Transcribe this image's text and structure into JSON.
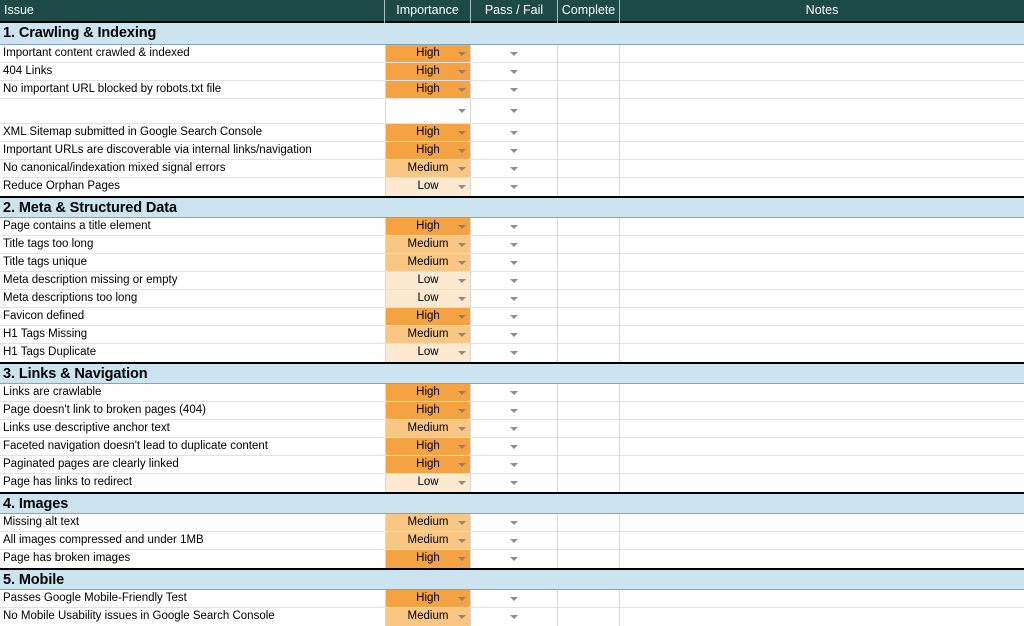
{
  "header": {
    "columns": [
      {
        "label": "Issue",
        "align": "left"
      },
      {
        "label": "Importance",
        "align": "center"
      },
      {
        "label": "Pass / Fail",
        "align": "center"
      },
      {
        "label": "Complete",
        "align": "center"
      },
      {
        "label": "Notes",
        "align": "center"
      }
    ]
  },
  "colors": {
    "header_background": "#1d4a47",
    "header_text": "#ffffff",
    "section_background": "#cce4ef",
    "importance_high": "#f5a342",
    "importance_medium": "#fac684",
    "importance_low": "#fde8d0",
    "grid_line": "#e2e2e2",
    "section_border": "#000000"
  },
  "icons": {
    "dropdown": "chevron-down-icon"
  },
  "sections": [
    {
      "title": "1. Crawling & Indexing",
      "rows": [
        {
          "issue": "Important content crawled & indexed",
          "importance": "High",
          "pass_fail": "",
          "complete": "",
          "notes": ""
        },
        {
          "issue": "404 Links",
          "importance": "High",
          "pass_fail": "",
          "complete": "",
          "notes": ""
        },
        {
          "issue": "No important URL blocked by robots.txt file",
          "importance": "High",
          "pass_fail": "",
          "complete": "",
          "notes": ""
        },
        {
          "issue": "",
          "importance": "",
          "pass_fail": "",
          "complete": "",
          "notes": ""
        },
        {
          "issue": "XML Sitemap submitted in Google Search Console",
          "importance": "High",
          "pass_fail": "",
          "complete": "",
          "notes": ""
        },
        {
          "issue": "Important URLs are discoverable via internal links/navigation",
          "importance": "High",
          "pass_fail": "",
          "complete": "",
          "notes": ""
        },
        {
          "issue": "No canonical/indexation mixed signal errors",
          "importance": "Medium",
          "pass_fail": "",
          "complete": "",
          "notes": ""
        },
        {
          "issue": "Reduce Orphan Pages",
          "importance": "Low",
          "pass_fail": "",
          "complete": "",
          "notes": ""
        }
      ]
    },
    {
      "title": "2. Meta & Structured Data",
      "rows": [
        {
          "issue": "Page contains a title element",
          "importance": "High",
          "pass_fail": "",
          "complete": "",
          "notes": ""
        },
        {
          "issue": "Title tags too long",
          "importance": "Medium",
          "pass_fail": "",
          "complete": "",
          "notes": ""
        },
        {
          "issue": "Title tags unique",
          "importance": "Medium",
          "pass_fail": "",
          "complete": "",
          "notes": ""
        },
        {
          "issue": "Meta description missing or empty",
          "importance": "Low",
          "pass_fail": "",
          "complete": "",
          "notes": ""
        },
        {
          "issue": "Meta descriptions too long",
          "importance": "Low",
          "pass_fail": "",
          "complete": "",
          "notes": ""
        },
        {
          "issue": "Favicon defined",
          "importance": "High",
          "pass_fail": "",
          "complete": "",
          "notes": ""
        },
        {
          "issue": "H1 Tags Missing",
          "importance": "Medium",
          "pass_fail": "",
          "complete": "",
          "notes": ""
        },
        {
          "issue": "H1 Tags Duplicate",
          "importance": "Low",
          "pass_fail": "",
          "complete": "",
          "notes": ""
        }
      ]
    },
    {
      "title": "3. Links & Navigation",
      "rows": [
        {
          "issue": "Links are crawlable",
          "importance": "High",
          "pass_fail": "",
          "complete": "",
          "notes": ""
        },
        {
          "issue": "Page doesn't link to broken pages (404)",
          "importance": "High",
          "pass_fail": "",
          "complete": "",
          "notes": ""
        },
        {
          "issue": "Links use descriptive anchor text",
          "importance": "Medium",
          "pass_fail": "",
          "complete": "",
          "notes": ""
        },
        {
          "issue": "Faceted navigation doesn't lead to duplicate content",
          "importance": "High",
          "pass_fail": "",
          "complete": "",
          "notes": ""
        },
        {
          "issue": "Paginated pages are clearly linked",
          "importance": "High",
          "pass_fail": "",
          "complete": "",
          "notes": ""
        },
        {
          "issue": "Page has links to redirect",
          "importance": "Low",
          "pass_fail": "",
          "complete": "",
          "notes": ""
        }
      ]
    },
    {
      "title": "4. Images",
      "rows": [
        {
          "issue": "Missing alt text",
          "importance": "Medium",
          "pass_fail": "",
          "complete": "",
          "notes": ""
        },
        {
          "issue": "All images compressed and under 1MB",
          "importance": "Medium",
          "pass_fail": "",
          "complete": "",
          "notes": ""
        },
        {
          "issue": "Page has broken images",
          "importance": "High",
          "pass_fail": "",
          "complete": "",
          "notes": ""
        }
      ]
    },
    {
      "title": "5. Mobile",
      "rows": [
        {
          "issue": "Passes Google Mobile-Friendly Test",
          "importance": "High",
          "pass_fail": "",
          "complete": "",
          "notes": ""
        },
        {
          "issue": "No Mobile Usability issues in Google Search Console",
          "importance": "Medium",
          "pass_fail": "",
          "complete": "",
          "notes": ""
        }
      ]
    }
  ]
}
